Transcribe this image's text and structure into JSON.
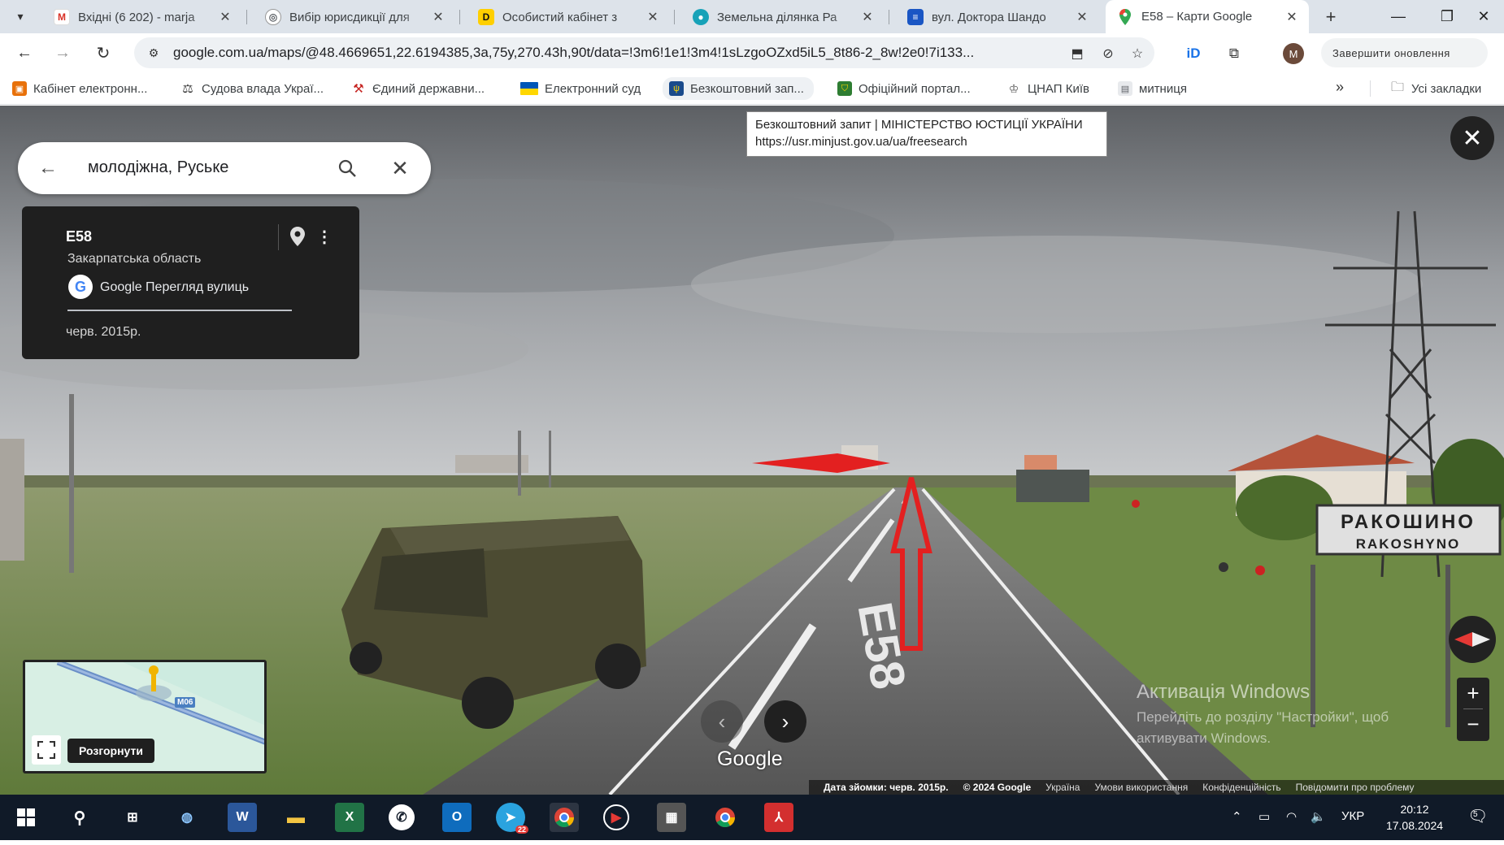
{
  "browser": {
    "tabs": [
      {
        "title": "Вхідні (6 202) - marja",
        "icon": "gmail-icon",
        "color": "#d93025",
        "glyph": "M"
      },
      {
        "title": "Вибір юрисдикції для",
        "icon": "globe-icon",
        "color": "#5f6368",
        "glyph": "◎"
      },
      {
        "title": "Особистий кабінет з",
        "icon": "diia-icon",
        "color": "#111111",
        "glyph": "D"
      },
      {
        "title": "Земельна ділянка Ра",
        "icon": "land-icon",
        "color": "#17a2b8",
        "glyph": "●"
      },
      {
        "title": "вул. Доктора Шандо",
        "icon": "doc-icon",
        "color": "#1a56c4",
        "glyph": "≡"
      },
      {
        "title": "E58 – Карти Google",
        "icon": "maps-pin-icon",
        "color": "#34a853",
        "glyph": "⬤",
        "active": true
      }
    ],
    "url": "google.com.ua/maps/@48.4669651,22.6194385,3a,75y,270.43h,90t/data=!3m6!1e1!3m4!1sLzgoOZxd5iL5_8t86-2_8w!2e0!7i133...",
    "update_button": "Завершити оновлення"
  },
  "bookmarks": [
    {
      "label": "Кабінет електронн...",
      "icon": "tax-cabinet-icon",
      "color": "#e8710a"
    },
    {
      "label": "Судова влада Украї...",
      "icon": "court-icon",
      "color": "#333333"
    },
    {
      "label": "Єдиний державни...",
      "icon": "registry-icon",
      "color": "#c5221f"
    },
    {
      "label": "Електронний суд",
      "icon": "ukraine-flag-icon",
      "color": "#0057b7"
    },
    {
      "label": "Безкоштовний зап...",
      "icon": "trident-icon",
      "color": "#1a4b8c"
    },
    {
      "label": "Офіційний портал...",
      "icon": "shield-icon",
      "color": "#2e7d32"
    },
    {
      "label": "ЦНАП Київ",
      "icon": "cnap-icon",
      "color": "#555555"
    },
    {
      "label": "митниця",
      "icon": "customs-icon",
      "color": "#5f6368"
    }
  ],
  "bookmarks_all": "Усі закладки",
  "maps": {
    "search_value": "молодіжна, Руське",
    "tooltip_title": "Безкоштовний запит | МІНІСТЕРСТВО ЮСТИЦІЇ УКРАЇНИ",
    "tooltip_url": "https://usr.minjust.gov.ua/ua/freesearch",
    "card_title": "E58",
    "card_region": "Закарпатська область",
    "card_source": "Google Перегляд вулиць",
    "card_date": "черв. 2015р.",
    "minimap_expand": "Розгорнути",
    "minimap_road": "M06",
    "watermark": "Google",
    "sign_ua": "РАКОШИНО",
    "sign_en": "RAKOSHYNO",
    "road_marking": "E58",
    "footer": {
      "capture_date": "Дата зйомки: черв. 2015р.",
      "copyright": "© 2024 Google",
      "country": "Україна",
      "terms": "Умови використання",
      "privacy": "Конфіденційність",
      "report": "Повідомити про проблему"
    },
    "activation_title": "Активація Windows",
    "activation_text": "Перейдіть до розділу \"Настройки\", щоб активувати Windows."
  },
  "taskbar": {
    "language": "УКР",
    "time": "20:12",
    "date": "17.08.2024",
    "telegram_badge": "22",
    "notification_count": "5"
  }
}
